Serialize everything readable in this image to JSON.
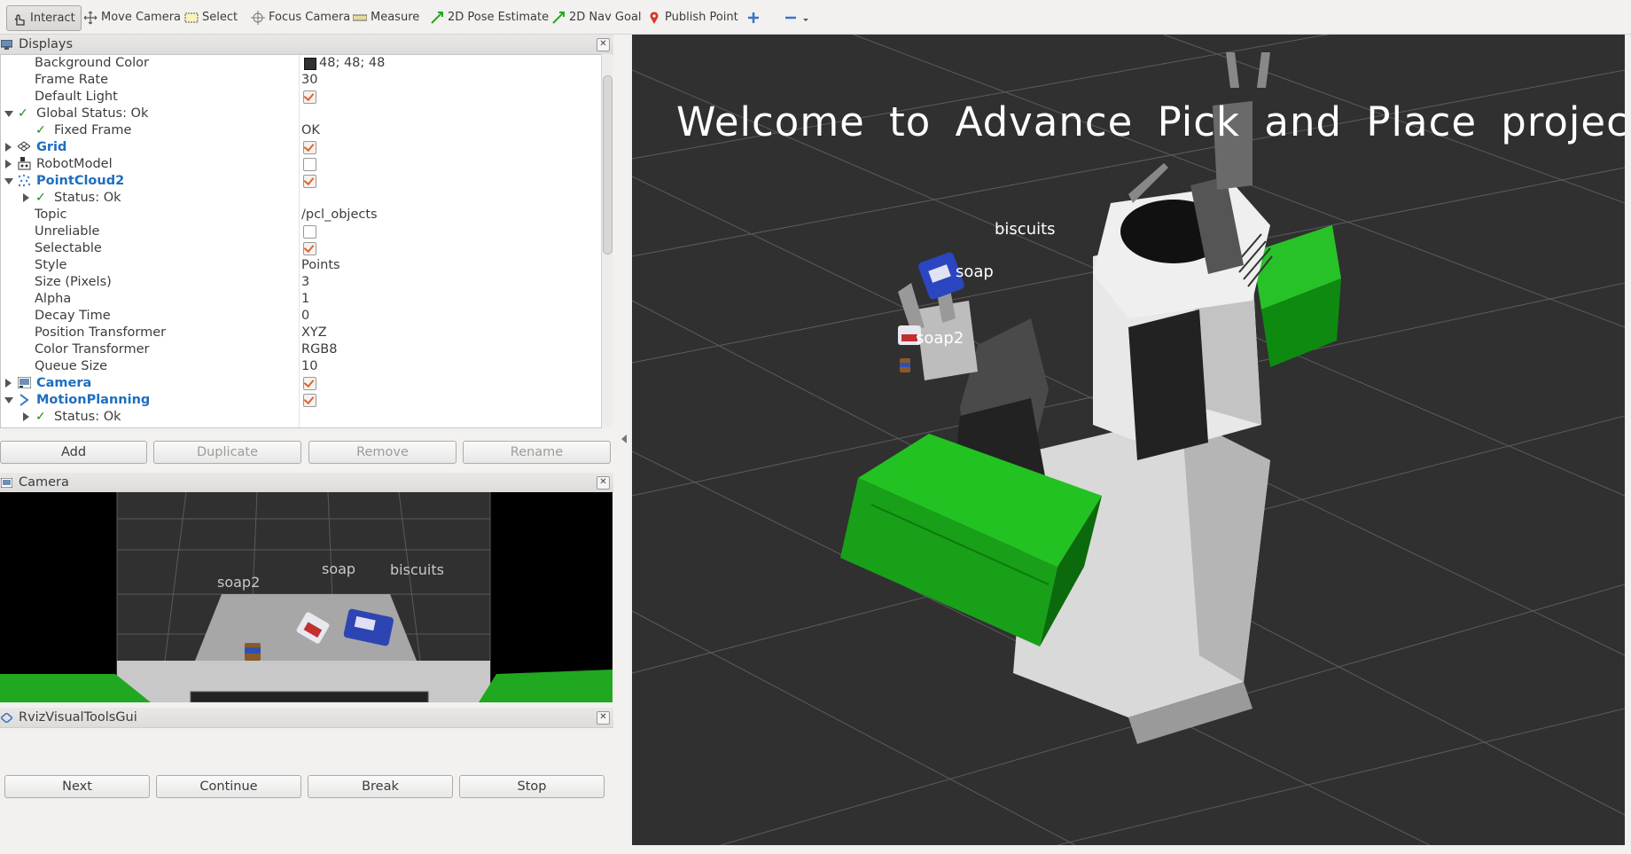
{
  "toolbar": {
    "interact": "Interact",
    "move_camera": "Move Camera",
    "select": "Select",
    "focus_camera": "Focus Camera",
    "measure": "Measure",
    "pose_estimate": "2D Pose Estimate",
    "nav_goal": "2D Nav Goal",
    "publish_point": "Publish Point"
  },
  "displays": {
    "title": "Displays",
    "rows": [
      {
        "name": "Background Color",
        "value": "48; 48; 48"
      },
      {
        "name": "Frame Rate",
        "value": "30"
      },
      {
        "name": "Default Light",
        "checked": true
      },
      {
        "name": "Global Status: Ok"
      },
      {
        "name": "Fixed Frame",
        "value": "OK"
      },
      {
        "name": "Grid",
        "checked": true
      },
      {
        "name": "RobotModel",
        "checked": false
      },
      {
        "name": "PointCloud2",
        "checked": true
      },
      {
        "name": "Status: Ok"
      },
      {
        "name": "Topic",
        "value": "/pcl_objects"
      },
      {
        "name": "Unreliable",
        "checked": false
      },
      {
        "name": "Selectable",
        "checked": true
      },
      {
        "name": "Style",
        "value": "Points"
      },
      {
        "name": "Size (Pixels)",
        "value": "3"
      },
      {
        "name": "Alpha",
        "value": "1"
      },
      {
        "name": "Decay Time",
        "value": "0"
      },
      {
        "name": "Position Transformer",
        "value": "XYZ"
      },
      {
        "name": "Color Transformer",
        "value": "RGB8"
      },
      {
        "name": "Queue Size",
        "value": "10"
      },
      {
        "name": "Camera",
        "checked": true
      },
      {
        "name": "MotionPlanning",
        "checked": true
      },
      {
        "name": "Status: Ok"
      }
    ],
    "buttons": {
      "add": "Add",
      "duplicate": "Duplicate",
      "remove": "Remove",
      "rename": "Rename"
    }
  },
  "camera": {
    "title": "Camera",
    "labels": {
      "soap2": "soap2",
      "soap": "soap",
      "biscuits": "biscuits"
    }
  },
  "rviz_tools": {
    "title": "RvizVisualToolsGui",
    "buttons": {
      "next": "Next",
      "continue": "Continue",
      "break": "Break",
      "stop": "Stop"
    }
  },
  "viewport": {
    "welcome": "Welcome to Advance Pick and Place project",
    "labels": {
      "biscuits": "biscuits",
      "soap": "soap",
      "soap2": "soap2"
    },
    "background": "#303030"
  },
  "colors": {
    "check": "#e0662d",
    "tick": "#1a8a1a",
    "link_blue": "#1e6ebf",
    "green_box": "#22b022"
  }
}
